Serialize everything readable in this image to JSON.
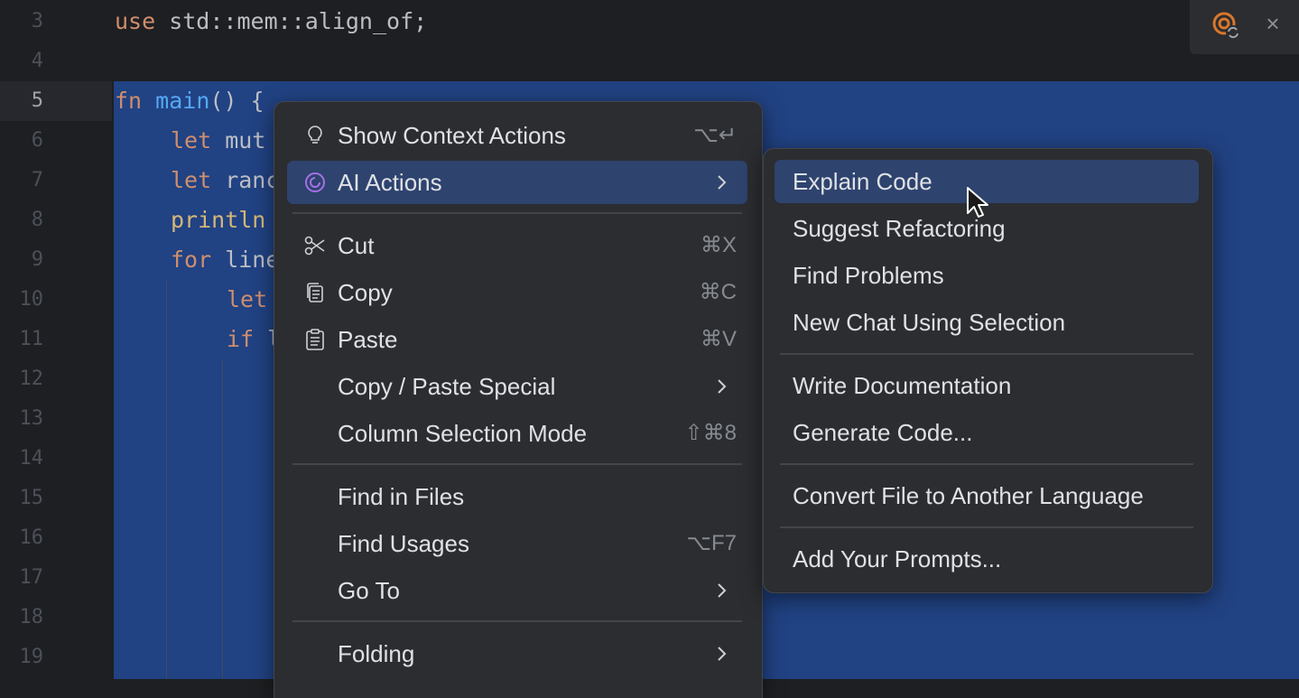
{
  "gutter": {
    "line_numbers": [
      "3",
      "4",
      "5",
      "6",
      "7",
      "8",
      "9",
      "10",
      "11",
      "12",
      "13",
      "14",
      "15",
      "16",
      "17",
      "18",
      "19"
    ]
  },
  "code": {
    "line3": {
      "kw": "use",
      "rest": " std::mem::align_of;"
    },
    "line5": {
      "kw": "fn",
      "name": "main",
      "rest": "() {"
    },
    "line6": {
      "kw": "let",
      "rest": " mut"
    },
    "line7": {
      "kw": "let",
      "rest": " ranc"
    },
    "line8": {
      "mac": "println"
    },
    "line9": {
      "kw": "for",
      "rest": " line"
    },
    "line10": {
      "kw": "let"
    },
    "line11": {
      "kw": "if",
      "rest": " l"
    }
  },
  "context_menu": {
    "show_context_actions": {
      "label": "Show Context Actions",
      "shortcut": "⌥↵"
    },
    "ai_actions": {
      "label": "AI Actions"
    },
    "cut": {
      "label": "Cut",
      "shortcut": "⌘X"
    },
    "copy": {
      "label": "Copy",
      "shortcut": "⌘C"
    },
    "paste": {
      "label": "Paste",
      "shortcut": "⌘V"
    },
    "copy_paste_special": {
      "label": "Copy / Paste Special"
    },
    "column_selection": {
      "label": "Column Selection Mode",
      "shortcut": "⇧⌘8"
    },
    "find_in_files": {
      "label": "Find in Files"
    },
    "find_usages": {
      "label": "Find Usages",
      "shortcut": "⌥F7"
    },
    "go_to": {
      "label": "Go To"
    },
    "folding": {
      "label": "Folding"
    }
  },
  "ai_submenu": {
    "items": [
      "Explain Code",
      "Suggest Refactoring",
      "Find Problems",
      "New Chat Using Selection",
      "Write Documentation",
      "Generate Code...",
      "Convert File to Another Language",
      "Add Your Prompts..."
    ]
  },
  "colors": {
    "selection": "#214283",
    "menu_bg": "#2b2d30",
    "highlight": "#2e436e",
    "ai_accent": "#a571e6"
  }
}
